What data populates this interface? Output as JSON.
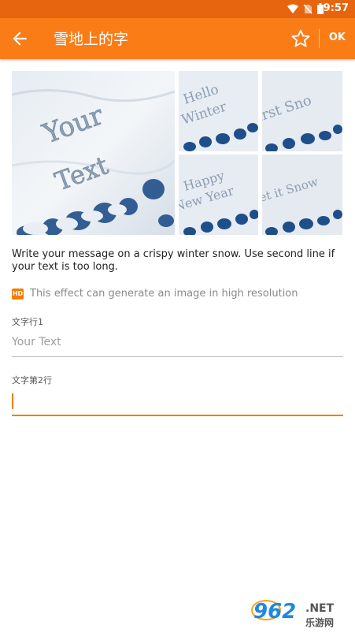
{
  "status_bar": {
    "time": "9:57"
  },
  "app_bar": {
    "title": "雪地上的字",
    "ok_label": "OK"
  },
  "gallery": {
    "main": {
      "lines": [
        "Your",
        "Text"
      ]
    },
    "thumbs": [
      {
        "lines": [
          "Hello",
          "Winter"
        ]
      },
      {
        "lines": [
          "irst Sno"
        ]
      },
      {
        "lines": [
          "Happy",
          "New Year"
        ]
      },
      {
        "lines": [
          "et it Snow"
        ]
      }
    ]
  },
  "description": "Write your message on a crispy winter snow. Use second line if your text is too long.",
  "hd_note": {
    "badge": "HD",
    "text": "This effect can generate an image in high resolution"
  },
  "fields": [
    {
      "label": "文字行1",
      "value": "",
      "placeholder": "Your Text"
    },
    {
      "label": "文字第2行",
      "value": "",
      "placeholder": ""
    }
  ],
  "watermark": {
    "number": "962",
    "suffix": ".NET",
    "sub": "乐游网"
  },
  "colors": {
    "accent": "#fa7c16",
    "status_bar": "#e8650f",
    "hd_badge": "#f57c00"
  }
}
